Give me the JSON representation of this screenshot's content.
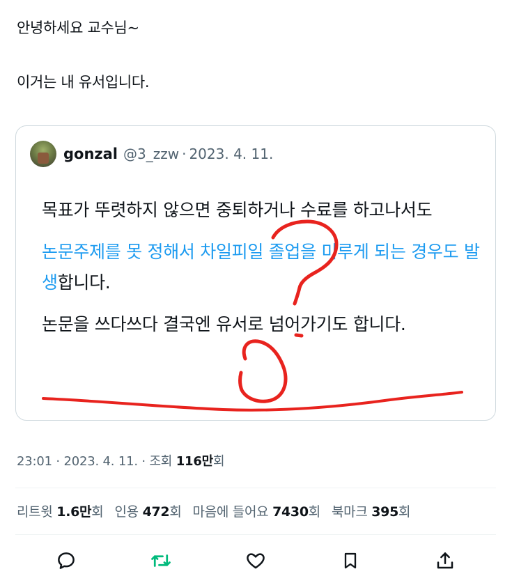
{
  "tweet": {
    "line1": "안녕하세요 교수님~",
    "line2": "이거는 내 유서입니다."
  },
  "quote": {
    "name": "gonzal",
    "handle": "@3_zzw",
    "separator": "·",
    "date": "2023. 4. 11.",
    "para1": "목표가 뚜렷하지 않으면 중퇴하거나 수료를 하고나서도",
    "para2_link": "논문주제를 못 정해서 차일피일 졸업을 미루게 되는 경우도 발생",
    "para2_tail": "합니다.",
    "para3": "논문을 쓰다쓰다 결국엔 유서로 넘어가기도 합니다."
  },
  "meta": {
    "time": "23:01",
    "sep1": "·",
    "date": "2023. 4. 11.",
    "sep2": "·",
    "views_label": "조회",
    "views_num": "116만",
    "views_unit": "회"
  },
  "stats": [
    {
      "label": "리트윗",
      "num": "1.6만",
      "unit": "회"
    },
    {
      "label": "인용",
      "num": "472",
      "unit": "회"
    },
    {
      "label": "마음에 들어요",
      "num": "7430",
      "unit": "회"
    },
    {
      "label": "북마크",
      "num": "395",
      "unit": "회"
    }
  ],
  "icons": {
    "reply": "speech-bubble-icon",
    "retweet": "retweet-icon",
    "like": "heart-icon",
    "bookmark": "bookmark-icon",
    "share": "share-icon"
  },
  "colors": {
    "link": "#1d9bf0",
    "retweet_active": "#00ba7c",
    "annotation": "#e8231e",
    "secondary": "#536471"
  }
}
